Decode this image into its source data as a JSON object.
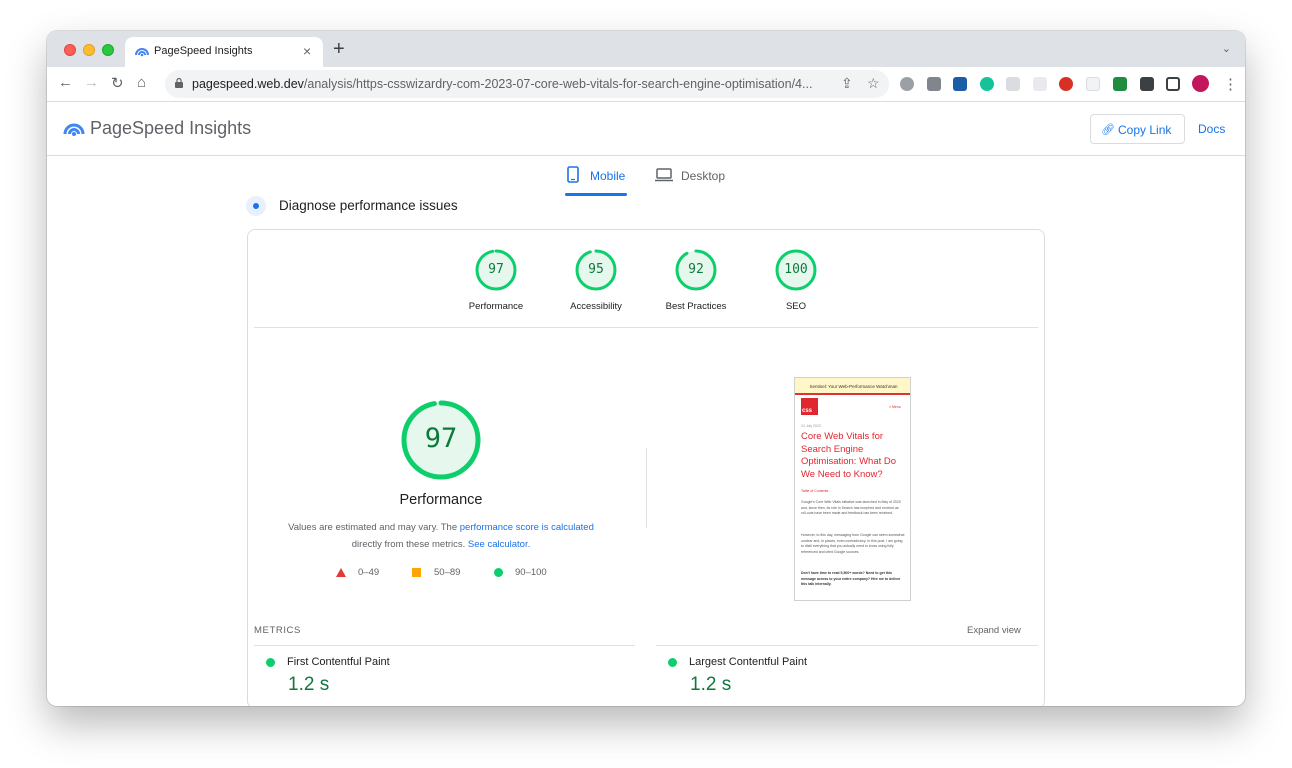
{
  "browser": {
    "tab_title": "PageSpeed Insights",
    "tab_close": "×",
    "new_tab": "+",
    "url_host": "pagespeed.web.dev",
    "url_path": "/analysis/https-csswizardry-com-2023-07-core-web-vitals-for-search-engine-optimisation/4..."
  },
  "header": {
    "title": "PageSpeed Insights",
    "copy_link": "Copy Link",
    "docs": "Docs"
  },
  "device_tabs": {
    "mobile": "Mobile",
    "desktop": "Desktop",
    "selected": "Mobile"
  },
  "section_title": "Diagnose performance issues",
  "scores": [
    {
      "label": "Performance",
      "value": 97
    },
    {
      "label": "Accessibility",
      "value": 95
    },
    {
      "label": "Best Practices",
      "value": 92
    },
    {
      "label": "SEO",
      "value": 100
    }
  ],
  "performance": {
    "score": 97,
    "title": "Performance",
    "note_prefix": "Values are estimated and may vary. The ",
    "note_link": "performance score is calculated",
    "note_middle": "directly from these metrics. ",
    "note_link2": "See calculator.",
    "legend": [
      "0–49",
      "50–89",
      "90–100"
    ]
  },
  "screenshot": {
    "banner": "Sentinel: Your Web-Performance Watchman",
    "logo": "css",
    "menu": "≡ Menu",
    "date": "24 July 2023",
    "title": "Core Web Vitals for Search Engine Optimisation: What Do We Need to Know?",
    "toc": "Table of Contents",
    "p1": "Google's Core Web Vitals initiative was launched in May of 2020 and, since then, its role in Search has morphed and evolved as roll-outs have been made and feedback has been received.",
    "p2": "However, to this day, messaging from Google can seem somewhat unclear and, in places, even contradictory. In this post, I am going to distil everything that you actually need to know using fully referenced and cited Google sources.",
    "p3": "Don't have time to read 5,500+ words? Need to get this message across to your entire company? Hire me to deliver this talk internally."
  },
  "metrics": {
    "label": "METRICS",
    "expand": "Expand view",
    "items": [
      {
        "name": "First Contentful Paint",
        "value": "1.2 s"
      },
      {
        "name": "Largest Contentful Paint",
        "value": "1.2 s"
      }
    ]
  },
  "colors": {
    "pass": "#0cce6b",
    "pass_text": "#0c7a3b",
    "average": "#ffa400",
    "fail": "#e53935",
    "link": "#1a73e8"
  }
}
